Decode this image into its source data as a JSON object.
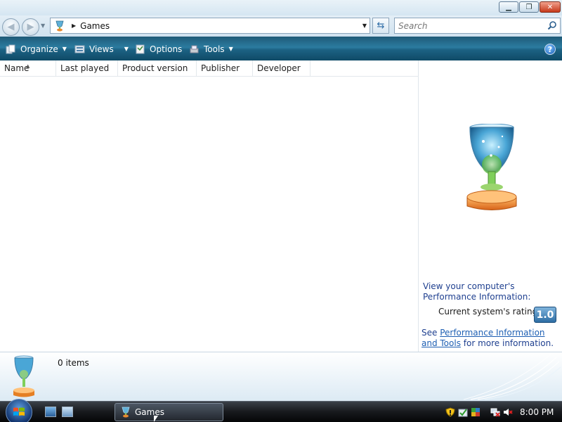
{
  "window": {
    "controls": {
      "minimize_icon": "minimize-icon",
      "maximize_icon": "maximize-icon",
      "close_icon": "close-icon"
    }
  },
  "address": {
    "breadcrumb_icon": "trophy-icon",
    "path": "Games"
  },
  "search": {
    "placeholder": "Search"
  },
  "toolbar": {
    "organize": "Organize",
    "views": "Views",
    "options": "Options",
    "tools": "Tools"
  },
  "columns": [
    "Name",
    "Last played",
    "Product version",
    "Publisher",
    "Developer"
  ],
  "details": {
    "perf_text": "View your computer's Performance Information:",
    "rating_label": "Current system's rating:",
    "rating_value": "1.0",
    "see_prefix": "See ",
    "see_link": "Performance Information and Tools",
    "see_suffix": " for more information."
  },
  "status": {
    "items": "0 items"
  },
  "taskbar": {
    "task_label": "Games",
    "clock": "8:00 PM"
  },
  "colors": {
    "command_bar": "#1f5a78",
    "link": "#1e5fb3",
    "rating_badge": "#2e6ea4"
  }
}
